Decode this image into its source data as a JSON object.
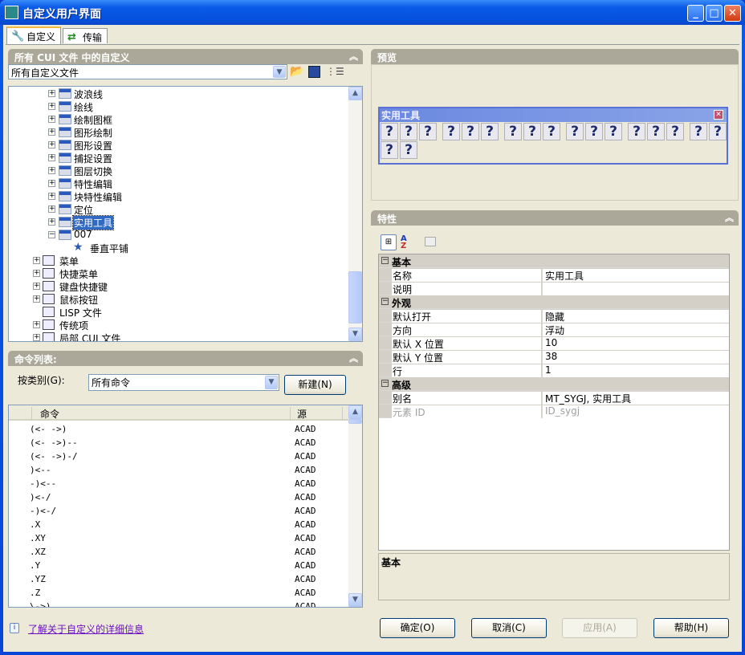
{
  "window": {
    "title": "自定义用户界面",
    "controls": [
      "minimize",
      "maximize",
      "close"
    ]
  },
  "tabs": [
    {
      "label": "自定义",
      "icon": "wrench-icon",
      "active": true
    },
    {
      "label": "传输",
      "icon": "transfer-arrows-icon",
      "active": false
    }
  ],
  "cui_panel": {
    "header": "所有 CUI 文件 中的自定义",
    "file_select": "所有自定义文件",
    "toolbar_icons": [
      "open-file-icon",
      "save-icon",
      "list-view-icon"
    ],
    "tree": [
      {
        "label": "波浪线",
        "level": 2,
        "expander": "+"
      },
      {
        "label": "绘线",
        "level": 2,
        "expander": "+"
      },
      {
        "label": "绘制图框",
        "level": 2,
        "expander": "+"
      },
      {
        "label": "图形绘制",
        "level": 2,
        "expander": "+"
      },
      {
        "label": "图形设置",
        "level": 2,
        "expander": "+"
      },
      {
        "label": "捕捉设置",
        "level": 2,
        "expander": "+"
      },
      {
        "label": "图层切换",
        "level": 2,
        "expander": "+"
      },
      {
        "label": "特性编辑",
        "level": 2,
        "expander": "+"
      },
      {
        "label": "块特性编辑",
        "level": 2,
        "expander": "+"
      },
      {
        "label": "定位",
        "level": 2,
        "expander": "+"
      },
      {
        "label": "实用工具",
        "level": 2,
        "expander": "+",
        "selected": true
      },
      {
        "label": "007",
        "level": 2,
        "expander": "-"
      },
      {
        "label": "垂直平铺",
        "level": 3,
        "icon": "star-icon"
      },
      {
        "label": "菜单",
        "level": 1,
        "expander": "+",
        "icon": "menu-icon"
      },
      {
        "label": "快捷菜单",
        "level": 1,
        "expander": "+",
        "icon": "shortcut-menu-icon"
      },
      {
        "label": "键盘快捷键",
        "level": 1,
        "expander": "+",
        "icon": "keyboard-icon"
      },
      {
        "label": "鼠标按钮",
        "level": 1,
        "expander": "+",
        "icon": "mouse-icon"
      },
      {
        "label": "LISP 文件",
        "level": 1,
        "icon": "lisp-icon"
      },
      {
        "label": "传统项",
        "level": 1,
        "expander": "+",
        "icon": "legacy-icon"
      },
      {
        "label": "局部 CUI 文件",
        "level": 1,
        "expander": "+",
        "icon": "partial-cui-icon"
      }
    ]
  },
  "command_panel": {
    "header": "命令列表:",
    "category_label": "按类别(G):",
    "category_value": "所有命令",
    "new_button": "新建(N)",
    "columns": [
      "命令",
      "源"
    ],
    "rows": [
      [
        "(<- ->)",
        "ACAD"
      ],
      [
        "(<- ->)--",
        "ACAD"
      ],
      [
        "(<- ->)-/",
        "ACAD"
      ],
      [
        ")<--",
        "ACAD"
      ],
      [
        "-)<--",
        "ACAD"
      ],
      [
        ")<-/",
        "ACAD"
      ],
      [
        "-)<-/",
        "ACAD"
      ],
      [
        ".X",
        "ACAD"
      ],
      [
        ".XY",
        "ACAD"
      ],
      [
        ".XZ",
        "ACAD"
      ],
      [
        ".Y",
        "ACAD"
      ],
      [
        ".YZ",
        "ACAD"
      ],
      [
        ".Z",
        "ACAD"
      ],
      [
        "\\->)",
        "ACAD"
      ]
    ]
  },
  "preview": {
    "header": "预览",
    "toolbar_title": "实用工具",
    "button_glyph": "?",
    "groups_row1": [
      3,
      3,
      3,
      3,
      3,
      2
    ],
    "row2_count": 2
  },
  "properties": {
    "header": "特性",
    "toolbar_icons": [
      "categorized-icon",
      "sort-az-icon",
      "property-pages-icon"
    ],
    "categories": [
      {
        "name": "基本",
        "rows": [
          [
            "名称",
            "实用工具"
          ],
          [
            "说明",
            ""
          ]
        ]
      },
      {
        "name": "外观",
        "rows": [
          [
            "默认打开",
            "隐藏"
          ],
          [
            "方向",
            "浮动"
          ],
          [
            "默认 X 位置",
            "10"
          ],
          [
            "默认 Y 位置",
            "38"
          ],
          [
            "行",
            "1"
          ]
        ]
      },
      {
        "name": "高级",
        "rows": [
          [
            "别名",
            "MT_SYGJ, 实用工具"
          ],
          [
            "元素 ID",
            "ID_sygj"
          ]
        ]
      }
    ],
    "description": "基本"
  },
  "footer": {
    "info_link": "了解关于自定义的详细信息",
    "buttons": [
      {
        "label": "确定(O)",
        "enabled": true
      },
      {
        "label": "取消(C)",
        "enabled": true
      },
      {
        "label": "应用(A)",
        "enabled": false
      },
      {
        "label": "帮助(H)",
        "enabled": true
      }
    ]
  }
}
